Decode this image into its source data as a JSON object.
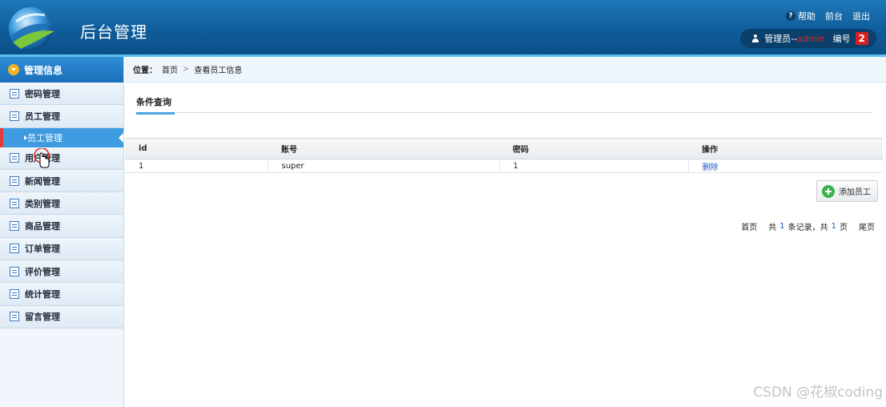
{
  "header": {
    "title": "后台管理",
    "help": "帮助",
    "front": "前台",
    "logout": "退出",
    "user_prefix": "管理员--",
    "user_name": "admin",
    "number_label": "编号",
    "number_value": "2"
  },
  "sidebar": {
    "head": "管理信息",
    "items": [
      {
        "label": "密码管理"
      },
      {
        "label": "员工管理"
      }
    ],
    "sub_item": "员工管理",
    "items_after": [
      {
        "label": "用户管理"
      },
      {
        "label": "新闻管理"
      },
      {
        "label": "类别管理"
      },
      {
        "label": "商品管理"
      },
      {
        "label": "订单管理"
      },
      {
        "label": "评价管理"
      },
      {
        "label": "统计管理"
      },
      {
        "label": "留言管理"
      }
    ]
  },
  "breadcrumb": {
    "label": "位置：",
    "home": "首页",
    "sep": ">",
    "current": "查看员工信息"
  },
  "tab": {
    "label": "条件查询"
  },
  "table": {
    "headers": [
      "id",
      "账号",
      "密码",
      "操作"
    ],
    "rows": [
      {
        "id": "1",
        "account": "super",
        "password": "1",
        "action": "删除"
      }
    ]
  },
  "add_button": "添加员工",
  "pager": {
    "first": "首页",
    "total_prefix": "共",
    "total_records": "1",
    "records_suffix": "条记录，共",
    "total_pages": "1",
    "pages_suffix": "页",
    "last": "尾页"
  },
  "watermark": "CSDN @花椒coding",
  "colors": {
    "header_blue": "#0f5c9a",
    "accent_blue": "#3e9be0",
    "link_blue": "#1e58c8",
    "danger_red": "#d71f1f"
  }
}
